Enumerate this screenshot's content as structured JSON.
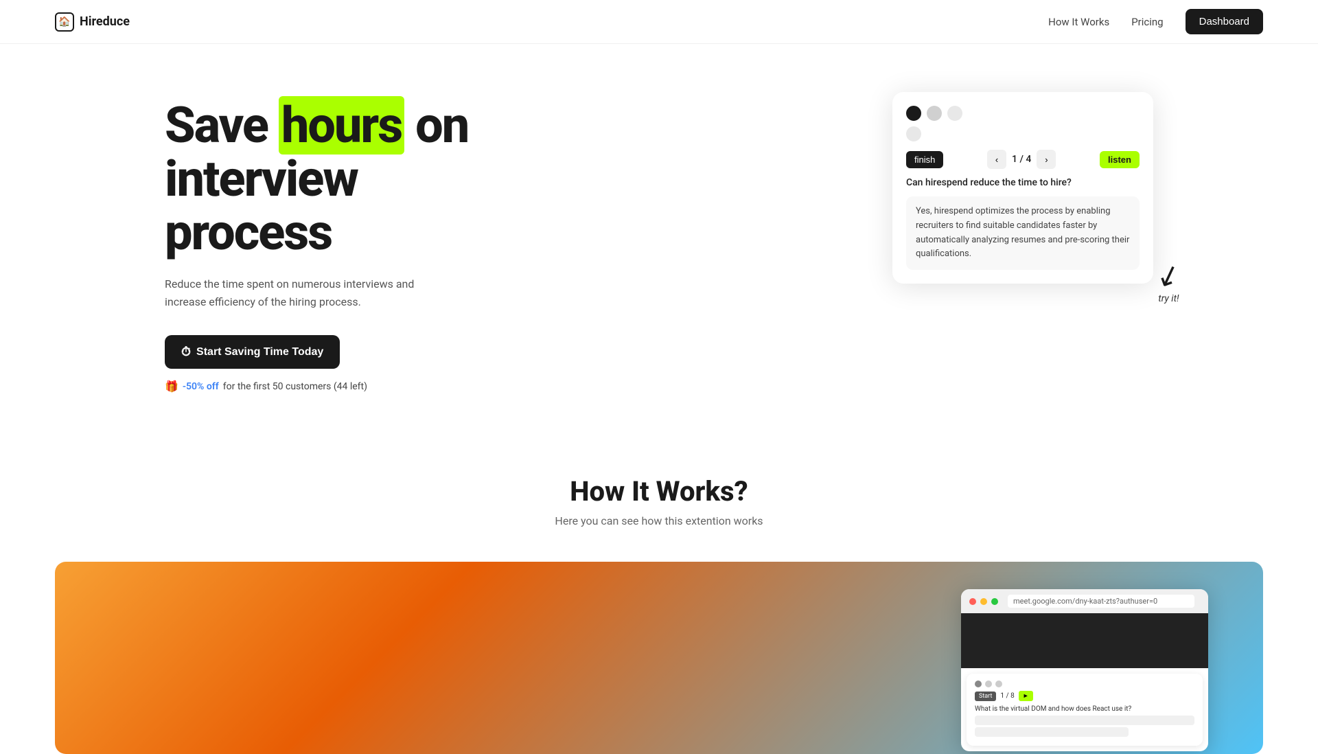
{
  "nav": {
    "logo_icon": "🏠",
    "logo_text": "Hireduce",
    "links": [
      {
        "id": "how-it-works",
        "label": "How It Works"
      },
      {
        "id": "pricing",
        "label": "Pricing"
      }
    ],
    "cta_label": "Dashboard"
  },
  "hero": {
    "title_before": "Save ",
    "title_highlight": "hours",
    "title_after": " on interview process",
    "subtitle": "Reduce the time spent on numerous interviews and increase efficiency of the hiring process.",
    "cta_label": "Start Saving Time Today",
    "promo_text": "-50% off",
    "promo_suffix": " for the first 50 customers (44 left)"
  },
  "qa_card": {
    "finish_label": "finish",
    "page": "1 / 4",
    "listen_label": "listen",
    "question": "Can hirespend reduce the time to hire?",
    "answer": "Yes, hirespend optimizes the process by enabling recruiters to find suitable candidates faster by automatically analyzing resumes and pre-scoring their qualifications.",
    "try_it_label": "try it!"
  },
  "how_section": {
    "title": "How It Works?",
    "subtitle": "Here you can see how this extention works"
  },
  "browser": {
    "url": "meet.google.com/dny-kaat-zts?authuser=0",
    "mini_page": "1 / 8",
    "mini_btn": "Start",
    "mini_btn2": "►",
    "mini_question": "What is the virtual DOM and how does React use it?"
  }
}
